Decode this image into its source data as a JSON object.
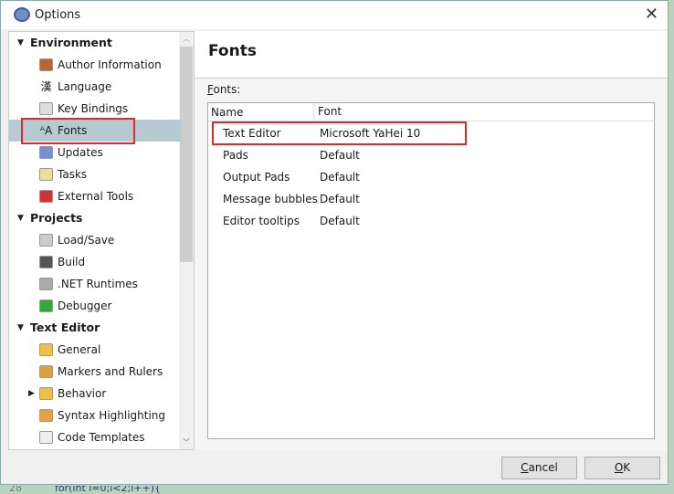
{
  "window": {
    "title": "Options",
    "close_icon": "close-icon"
  },
  "tree": {
    "categories": [
      {
        "label": "Environment",
        "items": [
          {
            "label": "Author Information",
            "icon": "monkey-icon"
          },
          {
            "label": "Language",
            "icon": "chinese-char-icon",
            "glyph": "漢"
          },
          {
            "label": "Key Bindings",
            "icon": "keyboard-key-icon"
          },
          {
            "label": "Fonts",
            "icon": "font-icon",
            "glyph": "ᴬA",
            "selected": true
          },
          {
            "label": "Updates",
            "icon": "globe-icon"
          },
          {
            "label": "Tasks",
            "icon": "clipboard-icon"
          },
          {
            "label": "External Tools",
            "icon": "tools-icon"
          }
        ]
      },
      {
        "label": "Projects",
        "items": [
          {
            "label": "Load/Save",
            "icon": "drive-icon"
          },
          {
            "label": "Build",
            "icon": "hammer-icon"
          },
          {
            "label": ".NET Runtimes",
            "icon": "gear-icon"
          },
          {
            "label": "Debugger",
            "icon": "bug-icon"
          }
        ]
      },
      {
        "label": "Text Editor",
        "items": [
          {
            "label": "General",
            "icon": "edit-icon"
          },
          {
            "label": "Markers and Rulers",
            "icon": "ruler-icon"
          },
          {
            "label": "Behavior",
            "icon": "edit-icon",
            "collapsed": true
          },
          {
            "label": "Syntax Highlighting",
            "icon": "highlight-icon"
          },
          {
            "label": "Code Templates",
            "icon": "template-icon"
          }
        ]
      }
    ]
  },
  "panel": {
    "title": "Fonts",
    "list_label": "Fonts:",
    "columns": [
      "Name",
      "Font"
    ],
    "rows": [
      [
        "Text Editor",
        "Microsoft YaHei 10"
      ],
      [
        "Pads",
        "Default"
      ],
      [
        "Output Pads",
        "Default"
      ],
      [
        "Message bubbles",
        "Default"
      ],
      [
        "Editor tooltips",
        "Default"
      ]
    ]
  },
  "buttons": {
    "cancel": "Cancel",
    "ok": "OK"
  },
  "background_code": {
    "line_number": "28",
    "text": "for(int i=0;i<2;i++){"
  },
  "colors": {
    "selection": "#b7c9d1",
    "highlight_box": "#e0262f"
  }
}
